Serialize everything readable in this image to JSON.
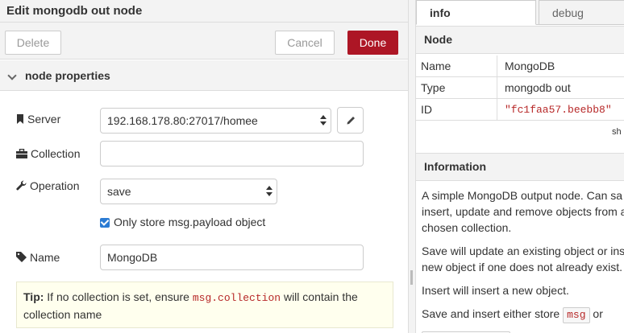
{
  "editor": {
    "title": "Edit mongodb out node",
    "delete_label": "Delete",
    "cancel_label": "Cancel",
    "done_label": "Done",
    "section_title": "node properties",
    "server": {
      "label": "Server",
      "value": "192.168.178.80:27017/homee",
      "icon": "bookmark-icon"
    },
    "collection": {
      "label": "Collection",
      "value": "",
      "icon": "briefcase-icon"
    },
    "operation": {
      "label": "Operation",
      "value": "save",
      "icon": "wrench-icon"
    },
    "only_payload": {
      "label": "Only store msg.payload object",
      "checked": true
    },
    "name": {
      "label": "Name",
      "value": "MongoDB",
      "icon": "tag-icon"
    },
    "tip": {
      "bold": "Tip:",
      "before": "If no collection is set, ensure",
      "code": "msg.collection",
      "after": "will contain the collection name"
    },
    "accent_color": "#ad1625",
    "checkbox_color": "#2b7bd3"
  },
  "sidebar": {
    "tabs": [
      {
        "label": "info",
        "active": true
      },
      {
        "label": "debug",
        "active": false
      }
    ],
    "node_section": "Node",
    "props": [
      {
        "key": "Name",
        "value": "MongoDB"
      },
      {
        "key": "Type",
        "value": "mongodb out"
      },
      {
        "key": "ID",
        "value": "\"fc1faa57.beebb8\""
      }
    ],
    "show_more": "sh",
    "info_section": "Information",
    "info_lines": [
      [
        "A simple MongoDB output node. Can sa",
        "insert, update and remove objects from a",
        "chosen collection."
      ],
      [
        "Save will update an existing object or ins",
        "new object if one does not already exist."
      ],
      [
        "Insert will insert a new object."
      ]
    ],
    "last_line": {
      "before": "Save and insert either store",
      "code": "msg",
      "after": "or"
    }
  }
}
